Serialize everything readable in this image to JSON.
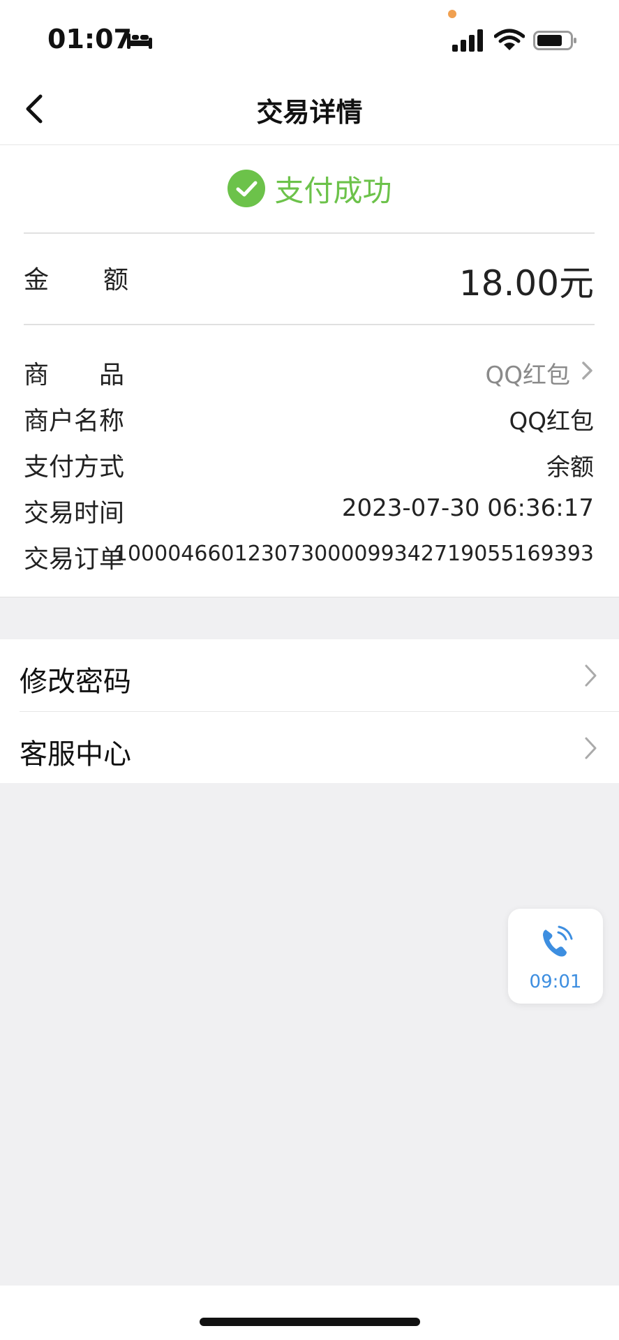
{
  "status_bar": {
    "time": "01:07"
  },
  "nav": {
    "title": "交易详情"
  },
  "payment": {
    "status": "支付成功",
    "amount_label": "金　　额",
    "amount": "18.00元"
  },
  "details": [
    {
      "label": "商　　品",
      "value": "QQ红包"
    },
    {
      "label": "商户名称",
      "value": "QQ红包"
    },
    {
      "label": "支付方式",
      "value": "余额"
    },
    {
      "label": "交易时间",
      "value": "2023-07-30 06:36:17"
    },
    {
      "label": "交易订单",
      "value": "100004660123073000099342719055169393"
    }
  ],
  "menu": [
    {
      "label": "修改密码"
    },
    {
      "label": "客服中心"
    }
  ],
  "call_widget": {
    "time": "09:01"
  },
  "colors": {
    "success": "#6cc24a",
    "call": "#3d8ee0",
    "background": "#f0f0f2"
  }
}
